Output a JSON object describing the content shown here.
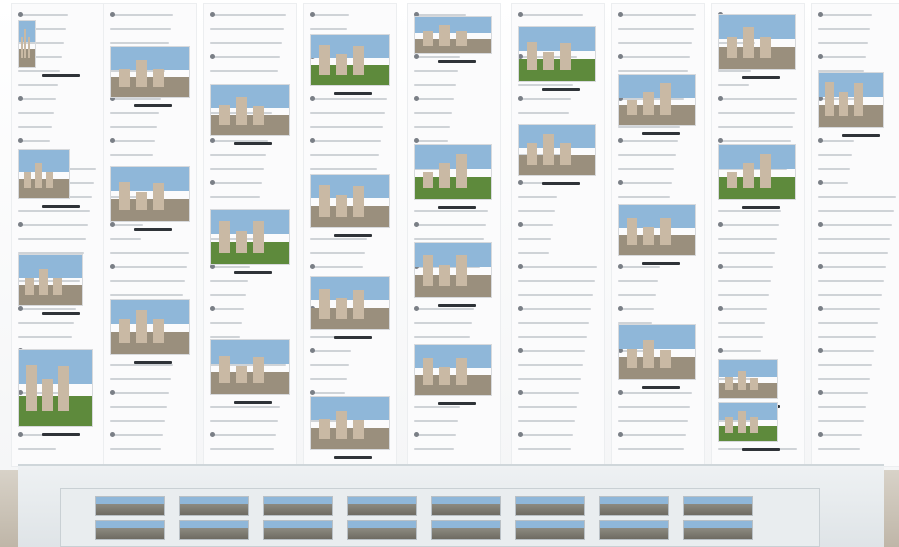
{
  "scene": {
    "description_label": "",
    "colors": {
      "wall": "#ffffff",
      "panel": "#fbfbfc",
      "sky": "#8fb7d9",
      "grass": "#5e8a3c",
      "concrete": "#c9b9a4",
      "vitrine": "#e4e9ec"
    }
  }
}
